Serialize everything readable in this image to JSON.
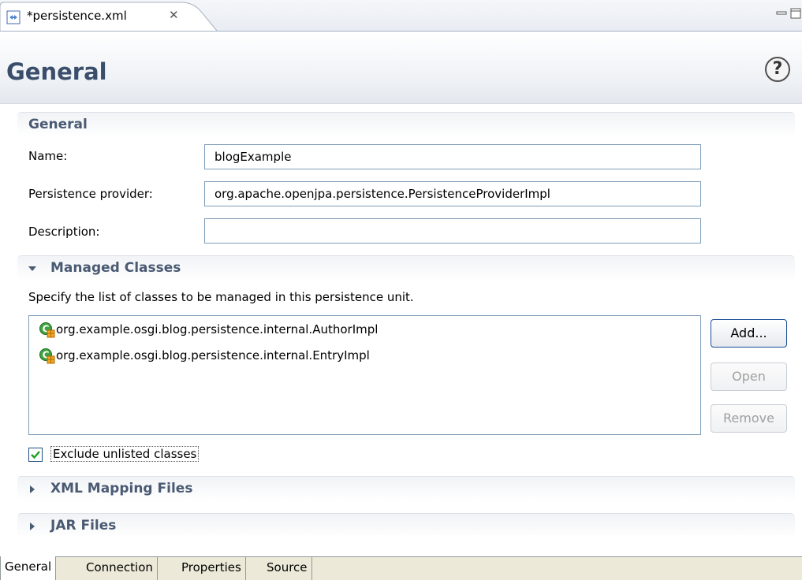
{
  "editor_tab": {
    "title": "*persistence.xml",
    "close_glyph": "✕"
  },
  "form": {
    "title": "General",
    "help_glyph": "?"
  },
  "general_section": {
    "title": "General",
    "name_label": "Name:",
    "name_value": "blogExample",
    "provider_label": "Persistence provider:",
    "provider_value": "org.apache.openjpa.persistence.PersistenceProviderImpl",
    "description_label": "Description:",
    "description_value": ""
  },
  "managed_classes": {
    "title": "Managed Classes",
    "expanded": true,
    "description": "Specify the list of classes to be managed in this persistence unit.",
    "items": [
      "org.example.osgi.blog.persistence.internal.AuthorImpl",
      "org.example.osgi.blog.persistence.internal.EntryImpl"
    ],
    "buttons": {
      "add": "Add...",
      "open": "Open",
      "remove": "Remove"
    },
    "exclude_label": "Exclude unlisted classes",
    "exclude_checked": true
  },
  "collapsed_sections": {
    "xml_mapping": "XML Mapping Files",
    "jar_files": "JAR Files"
  },
  "page_tabs": [
    "General",
    "Connection",
    "Properties",
    "Source"
  ],
  "colors": {
    "title": "#3a4e6b",
    "section_title": "#4a5a72",
    "input_border": "#7f9db9",
    "check": "#21a121"
  }
}
